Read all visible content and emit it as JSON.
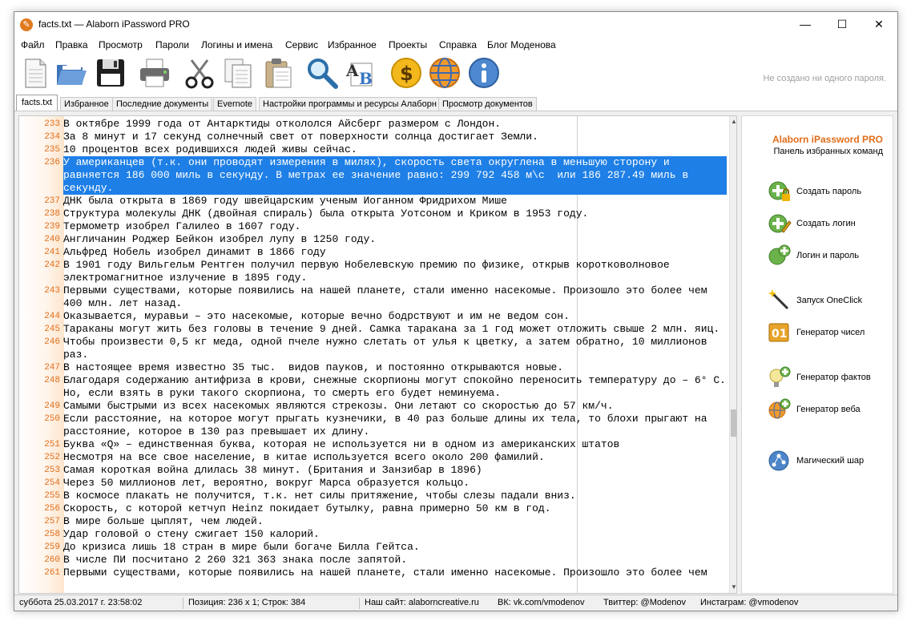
{
  "window": {
    "title": "facts.txt — Alaborn iPassword PRO"
  },
  "menu": [
    "Файл",
    "Правка",
    "Просмотр",
    "Пароли",
    "Логины и имена",
    "Сервис",
    "Избранное",
    "Проекты",
    "Справка",
    "Блог Моденова"
  ],
  "toolbar": {
    "icons": [
      "new-document-icon",
      "open-folder-icon",
      "save-icon",
      "print-icon",
      "cut-icon",
      "copy-icon",
      "paste-icon",
      "find-icon",
      "spellcheck-icon",
      "donate-icon",
      "web-icon",
      "info-icon"
    ],
    "status": "Не создано ни одного пароля."
  },
  "tabs": [
    "facts.txt",
    "Избранное",
    "Последние документы",
    "Evernote",
    "Настройки программы и ресурсы Алаборн",
    "Просмотр документов"
  ],
  "editor": {
    "lines": [
      {
        "n": "233",
        "t": "В октябре 1999 года от Антарктиды откололся Айсберг размером с Лондон."
      },
      {
        "n": "234",
        "t": "За 8 минут и 17 секунд солнечный свет от поверхности солнца достигает Земли."
      },
      {
        "n": "235",
        "t": "10 процентов всех родившихся людей живы сейчас."
      },
      {
        "n": "236",
        "t": "У американцев (т.к. они проводят измерения в милях), скорость света округлена в меньшую сторону и равняется 186 000 миль в секунду. В метрах ее значение равно: 299 792 458 м\\с  или 186 287.49 миль в секунду.",
        "sel": true
      },
      {
        "n": "237",
        "t": "ДНК была открыта в 1869 году швейцарским ученым Иоганном Фридрихом Мише"
      },
      {
        "n": "238",
        "t": "Структура молекулы ДНК (двойная спираль) была открыта Уотсоном и Криком в 1953 году."
      },
      {
        "n": "239",
        "t": "Термометр изобрел Галилео в 1607 году."
      },
      {
        "n": "240",
        "t": "Англичанин Роджер Бейкон изобрел лупу в 1250 году."
      },
      {
        "n": "241",
        "t": "Альфред Нобель изобрел динамит в 1866 году"
      },
      {
        "n": "242",
        "t": "В 1901 году Вильгельм Рентген получил первую Нобелевскую премию по физике, открыв коротковолновое электромагнитное излучение в 1895 году."
      },
      {
        "n": "243",
        "t": "Первыми существами, которые появились на нашей планете, стали именно насекомые. Произошло это более чем 400 млн. лет назад."
      },
      {
        "n": "244",
        "t": "Оказывается, муравьи – это насекомые, которые вечно бодрствуют и им не ведом сон."
      },
      {
        "n": "245",
        "t": "Тараканы могут жить без головы в течение 9 дней. Самка таракана за 1 год может отложить свыше 2 млн. яиц."
      },
      {
        "n": "246",
        "t": "Чтобы произвести 0,5 кг меда, одной пчеле нужно слетать от улья к цветку, а затем обратно, 10 миллионов раз."
      },
      {
        "n": "247",
        "t": "В настоящее время известно 35 тыс.  видов пауков, и постоянно открываются новые."
      },
      {
        "n": "248",
        "t": "Благодаря содержанию антифриза в крови, снежные скорпионы могут спокойно переносить температуру до – 6° С. Но, если взять в руки такого скорпиона, то смерть его будет неминуема."
      },
      {
        "n": "249",
        "t": "Самыми быстрыми из всех насекомых являются стрекозы. Они летают со скоростью до 57 км/ч."
      },
      {
        "n": "250",
        "t": "Если расстояние, на которое могут прыгать кузнечики, в 40 раз больше длины их тела, то блохи прыгают на расстояние, которое в 130 раз превышает их длину."
      },
      {
        "n": "251",
        "t": "Буква «Q» – единственная буква, которая не используется ни в одном из американских штатов"
      },
      {
        "n": "252",
        "t": "Несмотря на все свое население, в китае используется всего около 200 фамилий."
      },
      {
        "n": "253",
        "t": "Самая короткая война длилась 38 минут. (Британия и Занзибар в 1896)"
      },
      {
        "n": "254",
        "t": "Через 50 миллионов лет, вероятно, вокруг Марса образуется кольцо."
      },
      {
        "n": "255",
        "t": "В космосе плакать не получится, т.к. нет силы притяжение, чтобы слезы падали вниз."
      },
      {
        "n": "256",
        "t": "Скорость, с которой кетчуп Heinz покидает бутылку, равна примерно 50 км в год."
      },
      {
        "n": "257",
        "t": "В мире больше цыплят, чем людей."
      },
      {
        "n": "258",
        "t": "Удар головой о стену сжигает 150 калорий."
      },
      {
        "n": "259",
        "t": "До кризиса лишь 18 стран в мире были богаче Билла Гейтса."
      },
      {
        "n": "260",
        "t": "В числе ПИ посчитано 2 260 321 363 знака после запятой."
      },
      {
        "n": "261",
        "t": "Первыми существами, которые появились на нашей планете, стали именно насекомые. Произошло это более чем"
      }
    ]
  },
  "panel": {
    "title": "Alaborn iPassword PRO",
    "subtitle": "Панель избранных команд",
    "commands": [
      {
        "label": "Создать пароль",
        "icon": "create-password-icon"
      },
      {
        "label": "Создать логин",
        "icon": "create-login-icon"
      },
      {
        "label": "Логин и пароль",
        "icon": "login-and-password-icon"
      },
      {
        "label": "Запуск OneClick",
        "icon": "magic-wand-icon"
      },
      {
        "label": "Генератор чисел",
        "icon": "number-generator-icon"
      },
      {
        "label": "Генератор фактов",
        "icon": "fact-generator-icon"
      },
      {
        "label": "Генератор веба",
        "icon": "web-generator-icon"
      },
      {
        "label": "Магический шар",
        "icon": "magic-ball-icon"
      }
    ]
  },
  "status": {
    "datetime": "суббота 25.03.2017 г. 23:58:02",
    "position": "Позиция: 236 x 1; Строк: 384",
    "site": "Наш сайт: alaborncreative.ru",
    "vk": "ВК: vk.com/vmodenov",
    "twitter": "Твиттер: @Modenov",
    "instagram": "Инстаграм: @vmodenov"
  },
  "colors": {
    "accent": "#e06d1a",
    "selection": "#1e7fe6"
  }
}
